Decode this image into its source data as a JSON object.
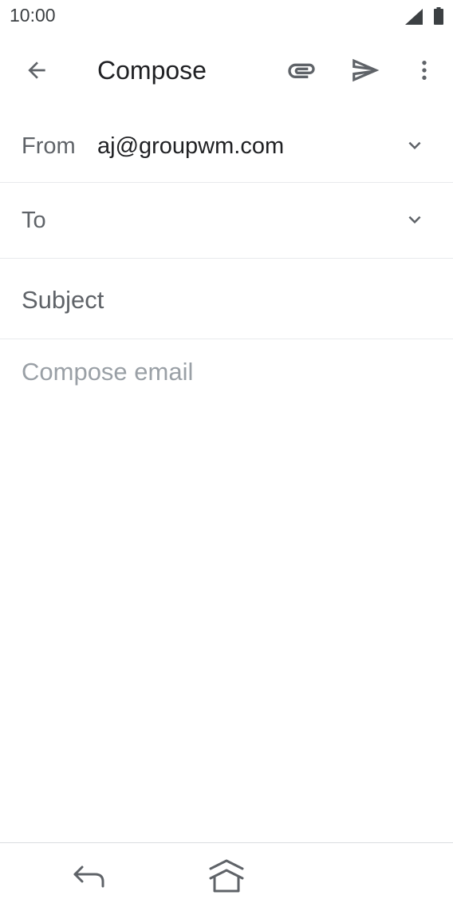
{
  "status_bar": {
    "time": "10:00",
    "icons": [
      "signal-icon",
      "battery-icon"
    ]
  },
  "app_bar": {
    "title": "Compose",
    "icons": [
      "arrow-left-icon",
      "paperclip-icon",
      "send-icon",
      "more-vert-icon"
    ]
  },
  "from": {
    "label": "From",
    "value": "aj@groupwm.com"
  },
  "to": {
    "label": "To",
    "value": ""
  },
  "subject": {
    "placeholder": "Subject",
    "value": ""
  },
  "body": {
    "placeholder": "Compose email",
    "value": ""
  },
  "colors": {
    "text_primary": "#202124",
    "text_secondary": "#5f6368",
    "placeholder": "#9aa0a6",
    "divider": "#e8eaed"
  }
}
